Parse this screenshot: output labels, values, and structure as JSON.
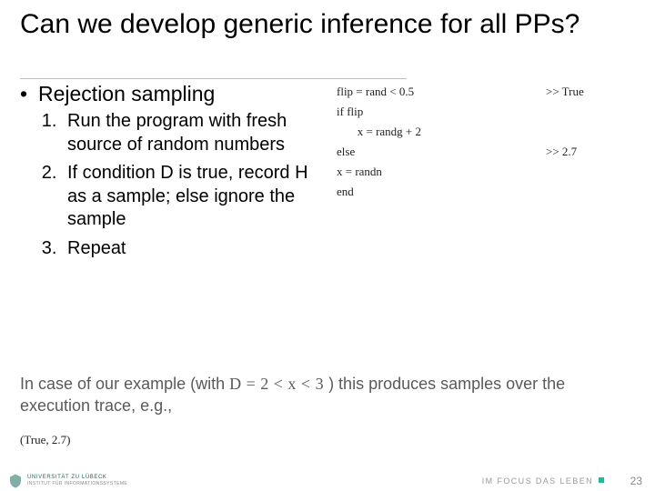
{
  "title": "Can we develop generic inference for all PPs?",
  "bullet": {
    "marker": "•",
    "text": "Rejection sampling"
  },
  "steps": [
    "Run the program with fresh source of random numbers",
    "If condition D is true, record H as a sample; else ignore the sample",
    "Repeat"
  ],
  "code": {
    "l1": "flip = rand < 0.5",
    "l2": "if flip",
    "l3": "       x = randg + 2",
    "l4": "else",
    "l5": "x = randn",
    "l6": "end"
  },
  "output": {
    "o1": ">> True",
    "o2": ">> 2.7"
  },
  "note": {
    "pre": "In case of our example (with ",
    "math": "D  =  2  <  x  <  3",
    "post": " ) this produces samples over the execution trace, e.g.,"
  },
  "tuple": "(True, 2.7)",
  "footer": {
    "uni_line1": "UNIVERSITÄT ZU LÜBECK",
    "uni_line2": "INSTITUT FÜR INFORMATIONSSYSTEME",
    "motto": "IM FOCUS DAS LEBEN",
    "pagenum": "23"
  }
}
